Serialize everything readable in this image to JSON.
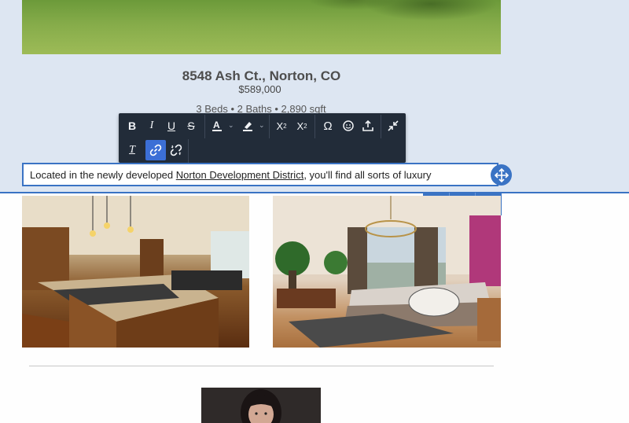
{
  "listing": {
    "address": "8548 Ash Ct., Norton, CO",
    "price": "$589,000",
    "specs": "3 Beds • 2 Baths • 2,890  sqft"
  },
  "toolbar": {
    "row1": [
      {
        "name": "bold",
        "glyph": "B"
      },
      {
        "name": "italic",
        "glyph": "I"
      },
      {
        "name": "underline",
        "glyph": "U"
      },
      {
        "name": "strikethrough",
        "glyph": "S"
      },
      {
        "name": "font-color",
        "glyph": "A"
      },
      {
        "name": "highlight",
        "glyph": "✎"
      },
      {
        "name": "superscript",
        "glyph": "X²"
      },
      {
        "name": "subscript",
        "glyph": "X₂"
      },
      {
        "name": "special-characters",
        "glyph": "Ω"
      },
      {
        "name": "emoji",
        "glyph": "☺"
      },
      {
        "name": "upload",
        "glyph": "⤓"
      },
      {
        "name": "collapse",
        "glyph": "↙"
      }
    ],
    "row2": [
      {
        "name": "clear-formatting",
        "glyph": "T"
      },
      {
        "name": "link",
        "glyph": "🔗"
      },
      {
        "name": "unlink",
        "glyph": "⛓"
      }
    ]
  },
  "editor": {
    "text_before": "Located in the newly developed ",
    "link_text": "Norton Development District",
    "text_after": ", you'll find all sorts of luxury"
  },
  "block_actions": {
    "icons": [
      "comment-icon",
      "trash-icon",
      "duplicate-icon"
    ]
  },
  "colors": {
    "accent": "#3a73c4",
    "toolbar_bg": "#222c39",
    "section_bg": "#dde6f2"
  }
}
